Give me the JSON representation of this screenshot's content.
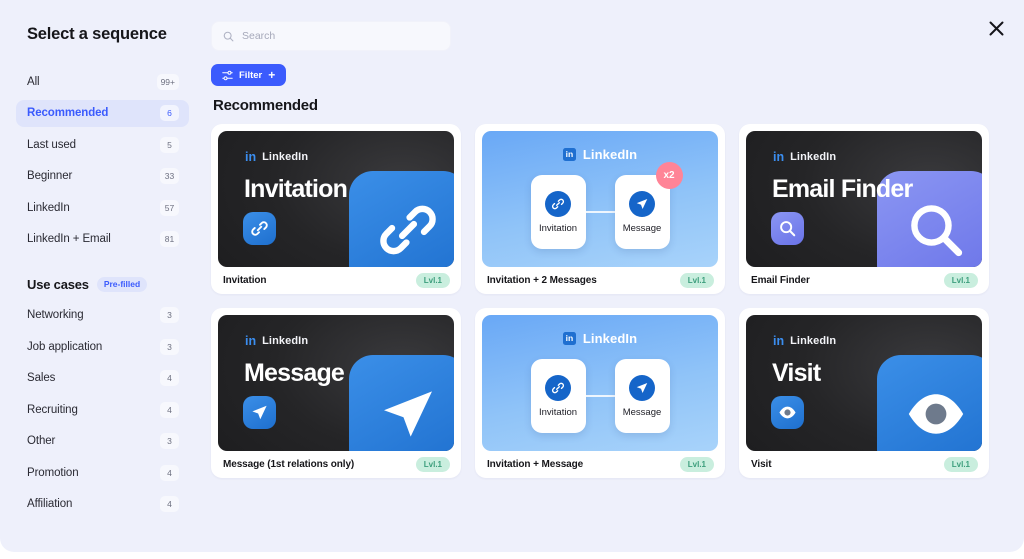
{
  "modal": {
    "title": "Select a sequence",
    "close_label": "✕"
  },
  "sidebar": {
    "filters": [
      {
        "label": "All",
        "count": "99+",
        "active": false
      },
      {
        "label": "Recommended",
        "count": "6",
        "active": true
      },
      {
        "label": "Last used",
        "count": "5",
        "active": false
      },
      {
        "label": "Beginner",
        "count": "33",
        "active": false
      },
      {
        "label": "LinkedIn",
        "count": "57",
        "active": false
      },
      {
        "label": "LinkedIn + Email",
        "count": "81",
        "active": false
      }
    ],
    "use_cases_title": "Use cases",
    "use_cases_badge": "Pre-filled",
    "use_cases": [
      {
        "label": "Networking",
        "count": "3"
      },
      {
        "label": "Job application",
        "count": "3"
      },
      {
        "label": "Sales",
        "count": "4"
      },
      {
        "label": "Recruiting",
        "count": "4"
      },
      {
        "label": "Other",
        "count": "3"
      },
      {
        "label": "Promotion",
        "count": "4"
      },
      {
        "label": "Affiliation",
        "count": "4"
      }
    ]
  },
  "search": {
    "placeholder": "Search",
    "value": ""
  },
  "toolbar": {
    "filter_label": "Filter",
    "filter_plus": "+"
  },
  "main": {
    "section_title": "Recommended",
    "cards": [
      {
        "name": "Invitation",
        "level": "Lvl.1",
        "style": "dark",
        "brand": "LinkedIn",
        "headline": "Invitation",
        "icon": "link-icon",
        "icon_color": "#1e6fce"
      },
      {
        "name": "Invitation + 2 Messages",
        "level": "Lvl.1",
        "style": "blue",
        "brand": "LinkedIn",
        "headline": "",
        "badge": "x2",
        "nodes": [
          {
            "label": "Invitation",
            "icon": "link-icon"
          },
          {
            "label": "Message",
            "icon": "send-icon"
          }
        ]
      },
      {
        "name": "Email Finder",
        "level": "Lvl.1",
        "style": "dark",
        "brand": "LinkedIn",
        "headline": "Email Finder",
        "icon": "magnifier-icon",
        "icon_color": "#6a73e8"
      },
      {
        "name": "Message (1st relations only)",
        "level": "Lvl.1",
        "style": "dark",
        "brand": "LinkedIn",
        "headline": "Message",
        "icon": "send-icon",
        "icon_color": "#1e6fce"
      },
      {
        "name": "Invitation + Message",
        "level": "Lvl.1",
        "style": "blue",
        "brand": "LinkedIn",
        "headline": "",
        "nodes": [
          {
            "label": "Invitation",
            "icon": "link-icon"
          },
          {
            "label": "Message",
            "icon": "send-icon"
          }
        ]
      },
      {
        "name": "Visit",
        "level": "Lvl.1",
        "style": "dark",
        "brand": "LinkedIn",
        "headline": "Visit",
        "icon": "eye-icon",
        "icon_color": "#1e6fce"
      }
    ]
  },
  "colors": {
    "accent": "#3b5bfd",
    "badge_level_bg": "#c9eede",
    "badge_level_text": "#3c9e7c",
    "badge_x2": "#ff8497",
    "modal_bg": "#eef0fb"
  }
}
